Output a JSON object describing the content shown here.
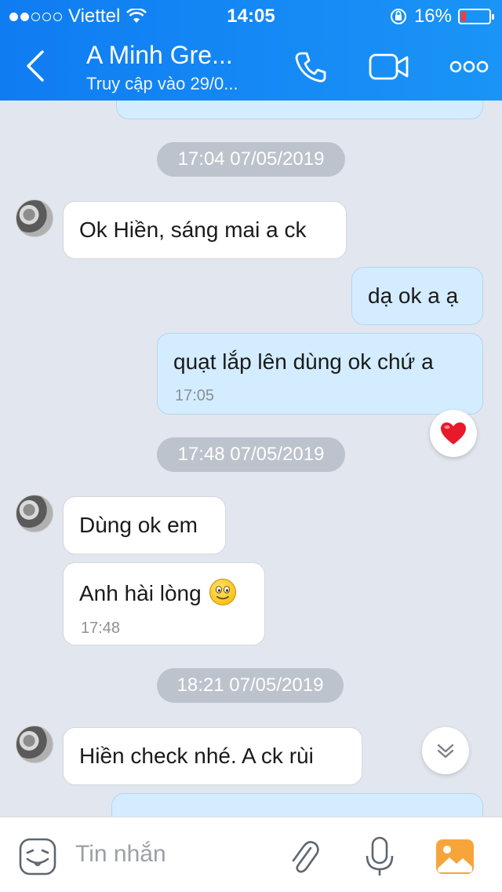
{
  "status_bar": {
    "carrier": "Viettel",
    "time": "14:05",
    "battery_percent": "16%"
  },
  "header": {
    "title": "A Minh Gre...",
    "subtitle": "Truy cập vào 29/0..."
  },
  "messages": [
    {
      "type": "date",
      "text": "17:04 07/05/2019"
    },
    {
      "type": "in",
      "text": "Ok Hiền, sáng mai a ck"
    },
    {
      "type": "out",
      "text": "dạ ok a ạ"
    },
    {
      "type": "out",
      "text": "quạt lắp lên dùng ok chứ a",
      "time": "17:05",
      "reaction": "heart"
    },
    {
      "type": "date",
      "text": "17:48 07/05/2019"
    },
    {
      "type": "in",
      "text": "Dùng ok em"
    },
    {
      "type": "in",
      "text": "Anh hài lòng",
      "emoji": "smiling-face",
      "time": "17:48"
    },
    {
      "type": "date",
      "text": "18:21 07/05/2019"
    },
    {
      "type": "in",
      "text": "Hiền check nhé. A ck rùi"
    }
  ],
  "input": {
    "placeholder": "Tin nhắn"
  },
  "colors": {
    "header": "#1a94f7",
    "outgoing_bubble": "#d3ecff",
    "incoming_bubble": "#ffffff",
    "background": "#e2e6ee",
    "heart": "#e8192c"
  }
}
